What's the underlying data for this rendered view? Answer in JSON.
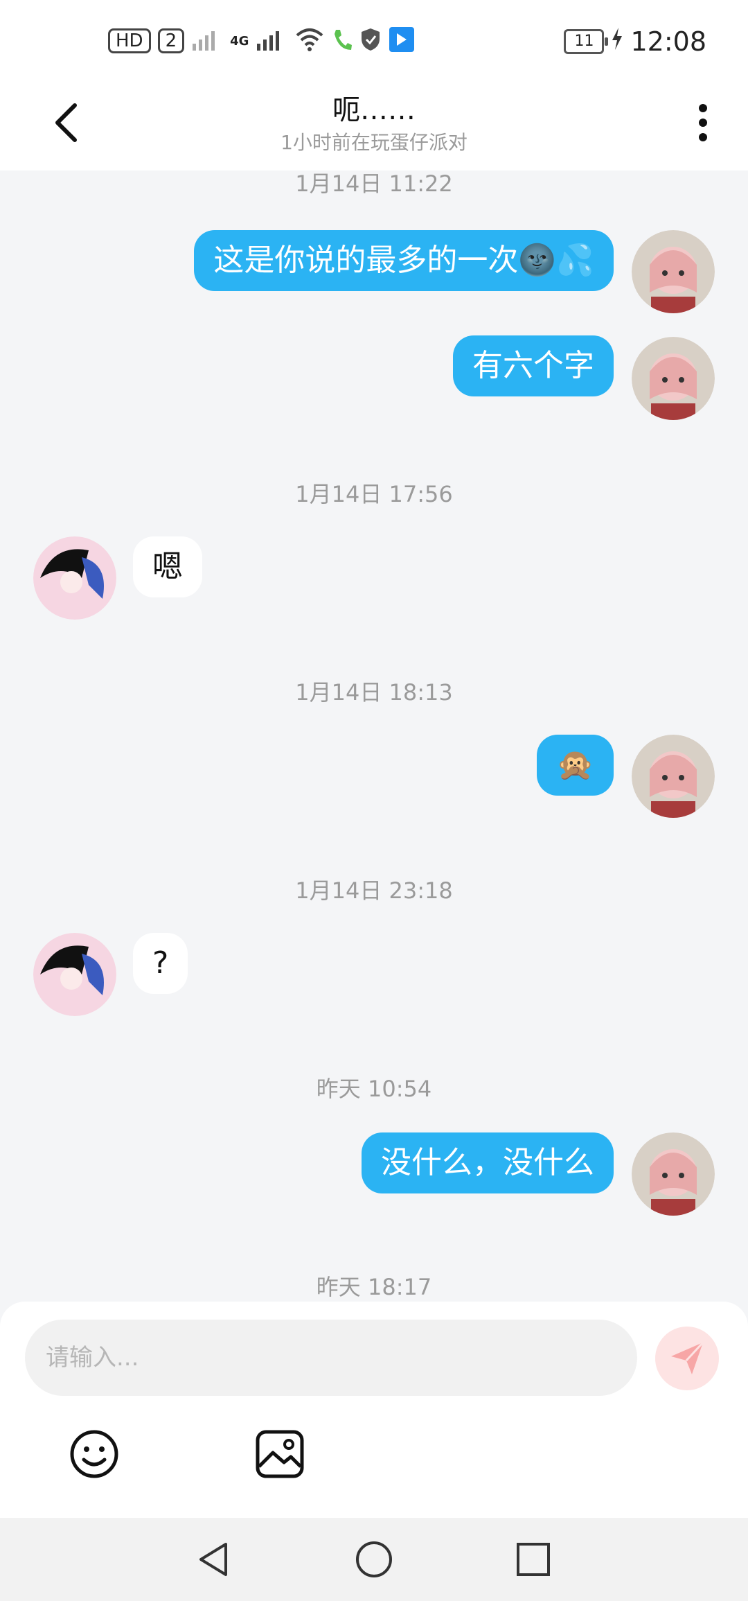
{
  "status_bar": {
    "left_badges": [
      "HD",
      "2",
      "4G"
    ],
    "battery": "11",
    "time": "12:08"
  },
  "header": {
    "title": "呃……",
    "subtitle": "1小时前在玩蛋仔派对",
    "back_icon": "chevron-left-icon",
    "more_icon": "more-vertical-icon"
  },
  "messages": [
    {
      "timestamp": "1月14日 11:22"
    },
    {
      "side": "out",
      "text": "这是你说的最多的一次🌚💦"
    },
    {
      "side": "out",
      "text": "有六个字"
    },
    {
      "timestamp": "1月14日 17:56"
    },
    {
      "side": "in",
      "text": "嗯"
    },
    {
      "timestamp": "1月14日 18:13"
    },
    {
      "side": "out",
      "text": "🙊"
    },
    {
      "timestamp": "1月14日 23:18"
    },
    {
      "side": "in",
      "text": "?"
    },
    {
      "timestamp": "昨天 10:54"
    },
    {
      "side": "out",
      "text": "没什么，没什么"
    },
    {
      "timestamp": "昨天 18:17"
    }
  ],
  "composer": {
    "placeholder": "请输入...",
    "send_icon": "send-icon",
    "emoji_icon": "emoji-icon",
    "image_icon": "image-icon"
  },
  "colors": {
    "outgoing_bubble": "#2bb3f3",
    "background": "#f4f5f7",
    "send_button": "#fde3e3"
  },
  "nav": [
    "back-triangle-icon",
    "home-circle-icon",
    "recents-square-icon"
  ]
}
